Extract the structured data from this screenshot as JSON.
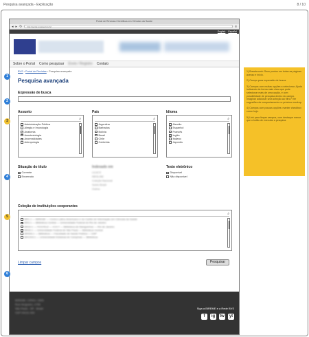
{
  "app": {
    "title": "Pesquisa avançada - Explicação",
    "page_counter": "8 / 10"
  },
  "browser": {
    "window_title": "Portal de Revistas Científicas em Ciências da Saúde",
    "url": "http://portal.revistas.bvs.br/",
    "nav_icons": [
      "back-icon",
      "forward-icon",
      "reload-icon",
      "menu-icon"
    ]
  },
  "lang": {
    "english": "English",
    "espanol": "Español"
  },
  "menu": {
    "items": [
      "Sobre o Portal",
      "Como pesquisar",
      "Envio / Registro",
      "Contato"
    ]
  },
  "breadcrumb": {
    "bvs": "BVS",
    "portal": "Portal de Revistas",
    "current": "Pesquisa avançada"
  },
  "page_title": "Pesquisa avançada",
  "search": {
    "label": "Expressão de busca",
    "value": ""
  },
  "filters": {
    "assunto": {
      "label": "Assunto",
      "items": [
        {
          "text": "Administração Pública",
          "checked": false
        },
        {
          "text": "Alergia e Imunologia",
          "checked": false
        },
        {
          "text": "Anatomia",
          "checked": true
        },
        {
          "text": "Anestesiologia",
          "checked": false
        },
        {
          "text": "Anormalidades",
          "checked": true
        },
        {
          "text": "Antropologia",
          "checked": false
        }
      ]
    },
    "pais": {
      "label": "País",
      "items": [
        {
          "text": "Argentina",
          "checked": false
        },
        {
          "text": "Barbados",
          "checked": false
        },
        {
          "text": "Bolívia",
          "checked": false
        },
        {
          "text": "Brasil",
          "checked": false
        },
        {
          "text": "Chile",
          "checked": false
        },
        {
          "text": "Colômbia",
          "checked": false
        }
      ]
    },
    "idioma": {
      "label": "Idioma",
      "items": [
        {
          "text": "Alemão",
          "checked": false
        },
        {
          "text": "Espanhol",
          "checked": false
        },
        {
          "text": "Francês",
          "checked": false
        },
        {
          "text": "Inglês",
          "checked": true
        },
        {
          "text": "Italiano",
          "checked": false
        },
        {
          "text": "Japonês",
          "checked": false
        }
      ]
    }
  },
  "situacao": {
    "label": "Situação do título",
    "items": [
      {
        "text": "Corrente",
        "checked": true
      },
      {
        "text": "Encerrado",
        "checked": false
      }
    ]
  },
  "indexado": {
    "label": "Indexado em",
    "items": [
      "LILACS",
      "MEDLINE",
      "Coleção Nacional",
      "Scielo Brasil",
      "Outros"
    ]
  },
  "texto": {
    "label": "Texto eletrônico",
    "items": [
      {
        "text": "Disponível",
        "checked": true
      },
      {
        "text": "Não disponível",
        "checked": false
      }
    ]
  },
  "colecao": {
    "label": "Coleção de instituições cooperantes",
    "items": [
      {
        "text": "BR1.1 — BIREME — Centro Latino-Americano e do Caribe de Informação em Ciências da Saúde",
        "checked": false
      },
      {
        "text": "BR3.1 — Biblioteca Central — Universidade Federal do Rio de Janeiro",
        "checked": true
      },
      {
        "text": "BR29.1 — FIOCRUZ — ICICT — Biblioteca de Manguinhos — Rio de Janeiro",
        "checked": false
      },
      {
        "text": "BR40.1 — Universidade Federal de São Paulo — Biblioteca Central",
        "checked": true
      },
      {
        "text": "BR526.1 — Biblioteca — Faculdade de Saúde Pública — USP",
        "checked": false
      },
      {
        "text": "BR1003.1 — Universidade Estadual de Campinas — Biblioteca",
        "checked": false
      }
    ]
  },
  "actions": {
    "clear": "Limpar campos",
    "search": "Pesquisar"
  },
  "footer": {
    "address_lines": [
      "BIREME / OPAS / OMS",
      "Rua Vergueiro, 1759",
      "São Paulo - SP - Brasil",
      "CEP 04101-000"
    ],
    "follow": "Siga a BIREME e a Rede BVS",
    "social": [
      "f",
      "ig",
      "tw",
      "yt"
    ]
  },
  "markers": {
    "m1": "1",
    "m2": "2",
    "m3": "3",
    "m4": "4",
    "m5": "5",
    "m6": "6"
  },
  "note": {
    "paragraphs": [
      "1) Breadcrumb: Seus pontos em todas as páginas acesso e início.",
      "2) Campo para expressão de busca.",
      "3) Campos com muitas opções a selecionar. Ajuda indicando da forma mais clara que pode selecionar mais de uma opção, e com possibilidade de pesquisa dentro do campo. Imaginar adicionar uma seleção ao filtro? Ver sugestões de comportamento no próximo mockup.",
      "4) Campos com poucas opções: manter checkbox como hoje.",
      "5) Link para limpar campos, com destaque menor que o botão de executar a pesquisa."
    ]
  },
  "colors": {
    "accent_blue": "#2f7fd8",
    "note_yellow": "#f5c128",
    "title_blue": "#1a3e78"
  }
}
